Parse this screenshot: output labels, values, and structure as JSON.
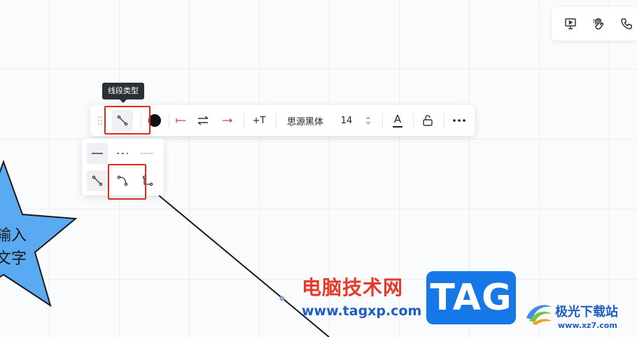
{
  "tooltip": {
    "text": "线段类型"
  },
  "toolbar": {
    "font_name": "思源黑体",
    "font_size": "14",
    "add_text_label": "+T",
    "text_color_label": "A",
    "colors": {
      "fill": "#111111",
      "arrow": "#e03a3a"
    }
  },
  "top_tools": {
    "icons": [
      "presentation-icon",
      "wave-hand-icon",
      "phone-icon"
    ]
  },
  "dropdown": {
    "styles": [
      "solid-line",
      "dashed-line",
      "dotted-line"
    ],
    "types": [
      "straight-connector",
      "curved-connector",
      "elbow-connector"
    ],
    "selected_type": "straight-connector"
  },
  "canvas": {
    "star_text_line1": "输入",
    "star_text_line2": "文字",
    "star_color": "#5aaaf2"
  },
  "watermark": {
    "title": "电脑技术网",
    "url": "www.tagxp.com",
    "tag": "TAG",
    "brand": "极光下载站",
    "brand_url": "www.xz7.com"
  }
}
